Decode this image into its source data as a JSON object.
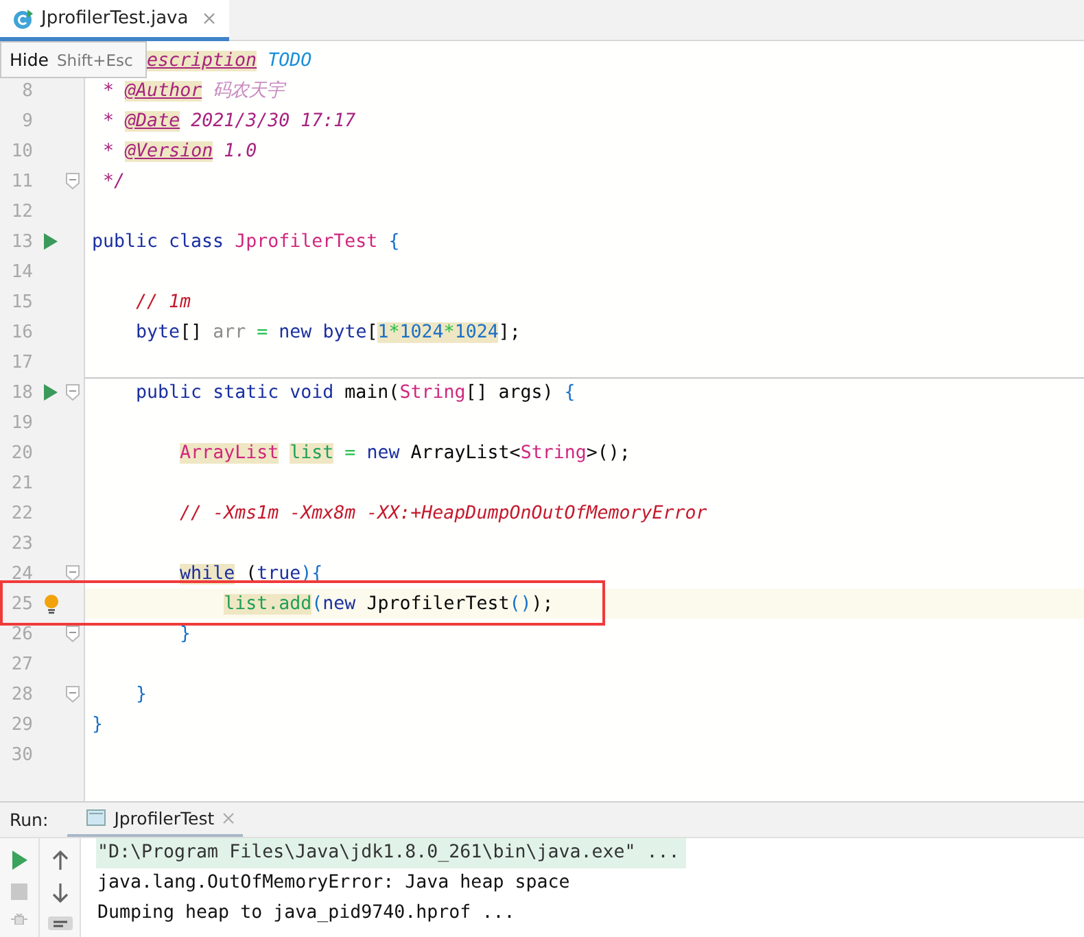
{
  "tabs": [
    {
      "label": "JprofilerTest.java",
      "selected": true
    }
  ],
  "hint_popup": {
    "action": "Hide",
    "shortcut": "Shift+Esc"
  },
  "editor": {
    "lines": [
      {
        "covered": true,
        "fold": false,
        "separator": false,
        "current": false,
        "boxed": false,
        "tokens": [
          {
            "t": "escription",
            "kind": "doctag",
            "hl": true
          },
          {
            "t": " TODO",
            "kind": "todo",
            "hl": false
          }
        ]
      },
      {
        "number": "8",
        "fold": false,
        "separator": false,
        "current": false,
        "boxed": false,
        "tokens": [
          {
            "t": " *",
            "kind": "doc",
            "hl": false
          },
          {
            "t": " @Author",
            "kind": "doctag",
            "hl": true
          },
          {
            "t": " 码农天宇",
            "kind": "doctext",
            "hl": false
          }
        ]
      },
      {
        "number": "9",
        "fold": false,
        "separator": false,
        "current": false,
        "boxed": false,
        "tokens": [
          {
            "t": " *",
            "kind": "doc",
            "hl": false
          },
          {
            "t": " @Date",
            "kind": "doctag",
            "hl": true
          },
          {
            "t": " 2021/3/30 17:17",
            "kind": "docval",
            "hl": false
          }
        ]
      },
      {
        "number": "10",
        "fold": false,
        "separator": false,
        "current": false,
        "boxed": false,
        "tokens": [
          {
            "t": " *",
            "kind": "doc",
            "hl": false
          },
          {
            "t": " @Version",
            "kind": "doctag",
            "hl": true
          },
          {
            "t": " 1.0",
            "kind": "docval",
            "hl": false
          }
        ]
      },
      {
        "number": "11",
        "fold": true,
        "separator": false,
        "current": false,
        "boxed": false,
        "tokens": [
          {
            "t": " */",
            "kind": "doc",
            "hl": false
          }
        ]
      },
      {
        "number": "12",
        "fold": false,
        "separator": false,
        "current": false,
        "boxed": false
      },
      {
        "number": "13",
        "kind": "run",
        "fold": false,
        "separator": false,
        "current": false,
        "boxed": false,
        "tokens": [
          {
            "t": "public class",
            "kind": "kw",
            "hl": false
          },
          {
            "t": " JprofilerTest",
            "kind": "type",
            "hl": false
          },
          {
            "t": " {",
            "kind": "brace",
            "hl": false
          }
        ]
      },
      {
        "number": "14",
        "fold": false,
        "separator": false,
        "current": false,
        "boxed": false
      },
      {
        "number": "15",
        "fold": false,
        "separator": false,
        "current": false,
        "boxed": false,
        "tokens": [
          {
            "t": "    // 1m",
            "kind": "comment",
            "hl": false
          }
        ]
      },
      {
        "number": "16",
        "fold": false,
        "separator": false,
        "current": false,
        "boxed": false,
        "tokens": [
          {
            "t": "    byte",
            "kind": "kw",
            "hl": false
          },
          {
            "t": "[]",
            "kind": "plain",
            "hl": false
          },
          {
            "t": " arr",
            "kind": "field",
            "hl": false
          },
          {
            "t": " =",
            "kind": "op",
            "hl": false
          },
          {
            "t": " new byte",
            "kind": "kw",
            "hl": false
          },
          {
            "t": "[",
            "kind": "plain",
            "hl": false
          },
          {
            "t": "1",
            "kind": "num",
            "hl": true
          },
          {
            "t": "*",
            "kind": "op",
            "hl": true
          },
          {
            "t": "1024",
            "kind": "num",
            "hl": true
          },
          {
            "t": "*",
            "kind": "op",
            "hl": true
          },
          {
            "t": "1024",
            "kind": "num",
            "hl": true
          },
          {
            "t": "];",
            "kind": "plain",
            "hl": false
          }
        ]
      },
      {
        "number": "17",
        "fold": false,
        "separator": false,
        "current": false,
        "boxed": false
      },
      {
        "number": "18",
        "kind": "run",
        "fold": true,
        "separator": true,
        "current": false,
        "boxed": false,
        "tokens": [
          {
            "t": "    public static void",
            "kind": "kw",
            "hl": false
          },
          {
            "t": " main(",
            "kind": "plain",
            "hl": false
          },
          {
            "t": "String",
            "kind": "type",
            "hl": false
          },
          {
            "t": "[] args)",
            "kind": "plain",
            "hl": false
          },
          {
            "t": " {",
            "kind": "brace",
            "hl": false
          }
        ]
      },
      {
        "number": "19",
        "fold": false,
        "separator": false,
        "current": false,
        "boxed": false
      },
      {
        "number": "20",
        "fold": false,
        "separator": false,
        "current": false,
        "boxed": false,
        "tokens": [
          {
            "t": "        ArrayList",
            "kind": "type",
            "hl": true
          },
          {
            "t": " list",
            "kind": "local",
            "hl": true
          },
          {
            "t": " =",
            "kind": "op",
            "hl": false
          },
          {
            "t": " new",
            "kind": "kw",
            "hl": false
          },
          {
            "t": " ArrayList<",
            "kind": "plain",
            "hl": false
          },
          {
            "t": "String",
            "kind": "type",
            "hl": false
          },
          {
            "t": ">();",
            "kind": "plain",
            "hl": false
          }
        ]
      },
      {
        "number": "21",
        "fold": false,
        "separator": false,
        "current": false,
        "boxed": false
      },
      {
        "number": "22",
        "fold": false,
        "separator": false,
        "current": false,
        "boxed": false,
        "tokens": [
          {
            "t": "        // -Xms1m -Xmx8m -XX:+HeapDumpOnOutOfMemoryError",
            "kind": "comment",
            "hl": false
          }
        ]
      },
      {
        "number": "23",
        "fold": false,
        "separator": false,
        "current": false,
        "boxed": false
      },
      {
        "number": "24",
        "fold": true,
        "separator": false,
        "current": false,
        "boxed": false,
        "tokens": [
          {
            "t": "        while",
            "kind": "kw",
            "hl": true
          },
          {
            "t": " (",
            "kind": "plain",
            "hl": false
          },
          {
            "t": "true",
            "kind": "kw",
            "hl": false
          },
          {
            "t": "){",
            "kind": "brace",
            "hl": false
          }
        ]
      },
      {
        "number": "25",
        "kind": "bulb",
        "fold": false,
        "separator": false,
        "current": true,
        "boxed": true,
        "tokens": [
          {
            "t": "            list.add",
            "kind": "local",
            "hl": true
          },
          {
            "t": "(",
            "kind": "brace",
            "hl": false
          },
          {
            "t": "new",
            "kind": "kw",
            "hl": false
          },
          {
            "t": " JprofilerTest",
            "kind": "plain",
            "hl": false
          },
          {
            "t": "()",
            "kind": "brace",
            "hl": false
          },
          {
            "t": ");",
            "kind": "plain",
            "hl": false
          }
        ]
      },
      {
        "number": "26",
        "fold": true,
        "separator": false,
        "current": false,
        "boxed": false,
        "tokens": [
          {
            "t": "        }",
            "kind": "brace",
            "hl": false
          }
        ]
      },
      {
        "number": "27",
        "fold": false,
        "separator": false,
        "current": false,
        "boxed": false
      },
      {
        "number": "28",
        "fold": true,
        "separator": false,
        "current": false,
        "boxed": false,
        "tokens": [
          {
            "t": "    }",
            "kind": "brace",
            "hl": false
          }
        ]
      },
      {
        "number": "29",
        "fold": false,
        "separator": false,
        "current": false,
        "boxed": false,
        "tokens": [
          {
            "t": "}",
            "kind": "brace",
            "hl": false
          }
        ]
      },
      {
        "number": "30",
        "fold": false,
        "separator": false,
        "current": false,
        "boxed": false
      }
    ]
  },
  "run_panel": {
    "label": "Run:",
    "tabs": [
      {
        "label": "JprofilerTest",
        "selected": true
      }
    ],
    "console": [
      {
        "text": "\"D:\\Program Files\\Java\\jdk1.8.0_261\\bin\\java.exe\" ...",
        "highlighted": true
      },
      {
        "text": "java.lang.OutOfMemoryError: Java heap space",
        "highlighted": false
      },
      {
        "text": "Dumping heap to java_pid9740.hprof ...",
        "highlighted": false
      }
    ]
  }
}
